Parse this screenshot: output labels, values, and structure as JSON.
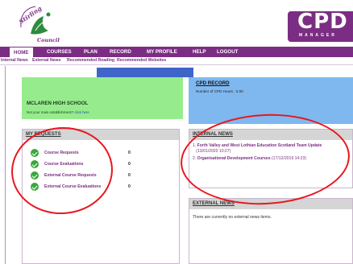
{
  "header": {
    "council_logo_text": "Stirling Council",
    "brand": "CPD",
    "brand_sub": "MANAGER"
  },
  "nav": {
    "items": [
      {
        "label": "HOME",
        "active": true
      },
      {
        "label": "COURSES"
      },
      {
        "label": "PLAN"
      },
      {
        "label": "RECORD"
      },
      {
        "label": "MY PROFILE"
      },
      {
        "label": "HELP"
      },
      {
        "label": "LOGOUT"
      }
    ]
  },
  "subnav": {
    "items": [
      {
        "label": "Internal News"
      },
      {
        "label": "External News"
      },
      {
        "label": "Recommended Reading"
      },
      {
        "label": "Recommended Websites"
      }
    ]
  },
  "school": {
    "name": "MCLAREN HIGH SCHOOL",
    "note_prefix": "Not your main establishment?",
    "note_link": "click here"
  },
  "record": {
    "title": "CPD RECORD",
    "hours": "Number of CPD Hours : 0.00"
  },
  "requests": {
    "title": "MY REQUESTS",
    "rows": [
      {
        "label": "Course Requests",
        "count": "0"
      },
      {
        "label": "Course Evaluations",
        "count": "0"
      },
      {
        "label": "External Course Requests",
        "count": "0"
      },
      {
        "label": "External Course Evaluations",
        "count": "0"
      }
    ]
  },
  "internal_news": {
    "title": "INTERNAL NEWS",
    "items": [
      {
        "num": "1.",
        "title": "Forth Valley and West Lothian Education Scotland Team Update",
        "date": "(13/01/2020 10:27)"
      },
      {
        "num": "2.",
        "title": "Organisational Development Courses",
        "date": "(17/12/2019 14:23)"
      }
    ]
  },
  "external_news": {
    "title": "EXTERNAL NEWS",
    "empty_text": "There are currently no external news items."
  },
  "colors": {
    "brand_purple": "#7b2d83",
    "school_green": "#96ec8c",
    "record_blue": "#7fb8ef",
    "bar_blue": "#3f65c9",
    "check_green": "#3aa83a",
    "annotation_red": "#e8171f"
  }
}
